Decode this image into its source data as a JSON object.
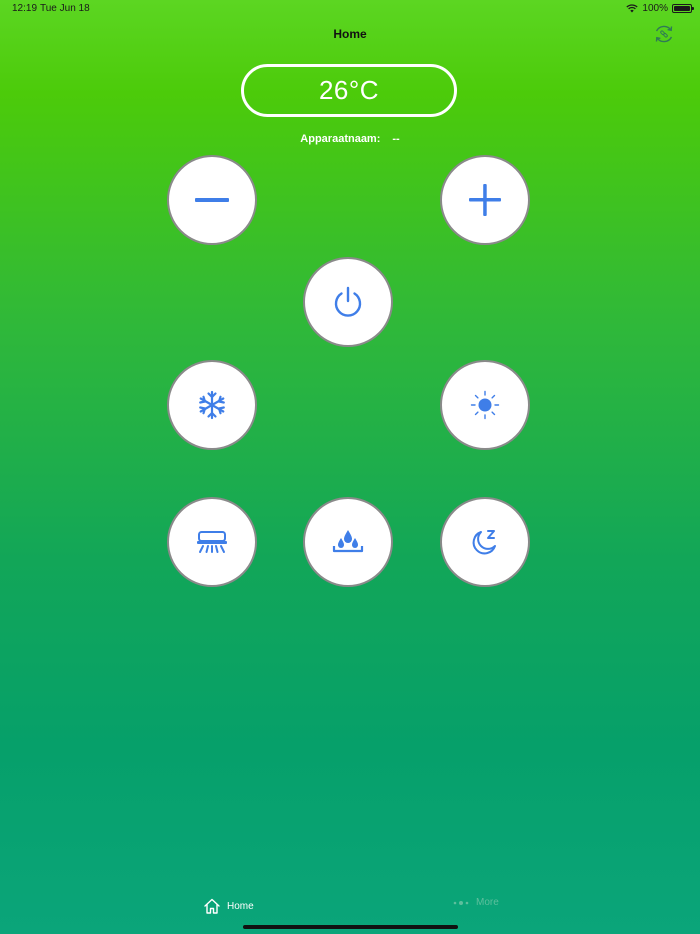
{
  "status_bar": {
    "time": "12:19",
    "date": "Tue Jun 18",
    "battery": "100%"
  },
  "nav": {
    "title": "Home",
    "refresh_icon": "refresh-link-icon"
  },
  "thermostat": {
    "temperature": "26°C",
    "device_label": "Apparaatnaam:",
    "device_value": "--"
  },
  "controls": [
    {
      "name": "minus",
      "icon": "minus-icon"
    },
    {
      "name": "plus",
      "icon": "plus-icon"
    },
    {
      "name": "power",
      "icon": "power-icon"
    },
    {
      "name": "cool",
      "icon": "snowflake-icon"
    },
    {
      "name": "heat",
      "icon": "sun-icon"
    },
    {
      "name": "fan",
      "icon": "air-vent-icon"
    },
    {
      "name": "dry",
      "icon": "water-drops-icon"
    },
    {
      "name": "sleep",
      "icon": "moon-sleep-icon"
    }
  ],
  "colors": {
    "icon_blue": "#3f7ee8",
    "button_border": "#8a8a8a",
    "gradient_top": "#5cd622",
    "gradient_bottom": "#0ba57a"
  },
  "tabs": [
    {
      "label": "Home",
      "icon": "house-icon",
      "active": true
    },
    {
      "label": "More",
      "icon": "dots-icon",
      "active": false
    }
  ]
}
